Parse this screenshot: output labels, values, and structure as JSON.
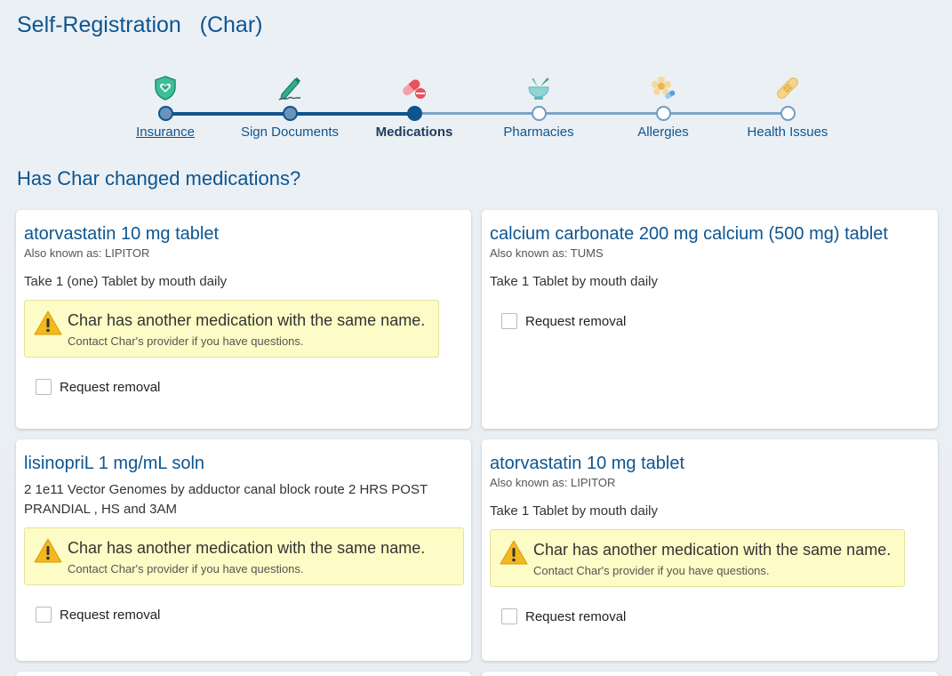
{
  "page": {
    "title": "Self-Registration   (Char)",
    "question": "Has Char changed medications?"
  },
  "stepper": {
    "steps": [
      {
        "label": "Insurance",
        "state": "completed",
        "icon": "shield-heart-icon"
      },
      {
        "label": "Sign Documents",
        "state": "completed",
        "icon": "pen-signature-icon"
      },
      {
        "label": "Medications",
        "state": "current",
        "icon": "pills-icon"
      },
      {
        "label": "Pharmacies",
        "state": "upcoming",
        "icon": "mortar-pestle-icon"
      },
      {
        "label": "Allergies",
        "state": "upcoming",
        "icon": "flower-pill-icon"
      },
      {
        "label": "Health Issues",
        "state": "upcoming",
        "icon": "bandage-icon"
      }
    ]
  },
  "medications": [
    {
      "name": "atorvastatin 10 mg tablet",
      "aka": "Also known as: LIPITOR",
      "sig": "Take 1 (one) Tablet by mouth daily",
      "warning_title": "Char has another medication with the same name.",
      "warning_sub": "Contact Char's provider if you have questions.",
      "removal_label": "Request removal"
    },
    {
      "name": "calcium carbonate 200 mg calcium (500 mg) tablet",
      "aka": "Also known as: TUMS",
      "sig": "Take 1 Tablet by mouth daily",
      "removal_label": "Request removal"
    },
    {
      "name": "lisinopriL 1 mg/mL soln",
      "sig": "2 1e11 Vector Genomes by adductor canal block route 2 HRS POST PRANDIAL , HS and 3AM",
      "warning_title": "Char has another medication with the same name.",
      "warning_sub": "Contact Char's provider if you have questions.",
      "removal_label": "Request removal"
    },
    {
      "name": "atorvastatin 10 mg tablet",
      "aka": "Also known as: LIPITOR",
      "sig": "Take 1 Tablet by mouth daily",
      "warning_title": "Char has another medication with the same name.",
      "warning_sub": "Contact Char's provider if you have questions.",
      "removal_label": "Request removal"
    }
  ],
  "colors": {
    "accent": "#0e5590",
    "warning_bg": "#fdfcc6",
    "warning_icon": "#f2b81d"
  }
}
